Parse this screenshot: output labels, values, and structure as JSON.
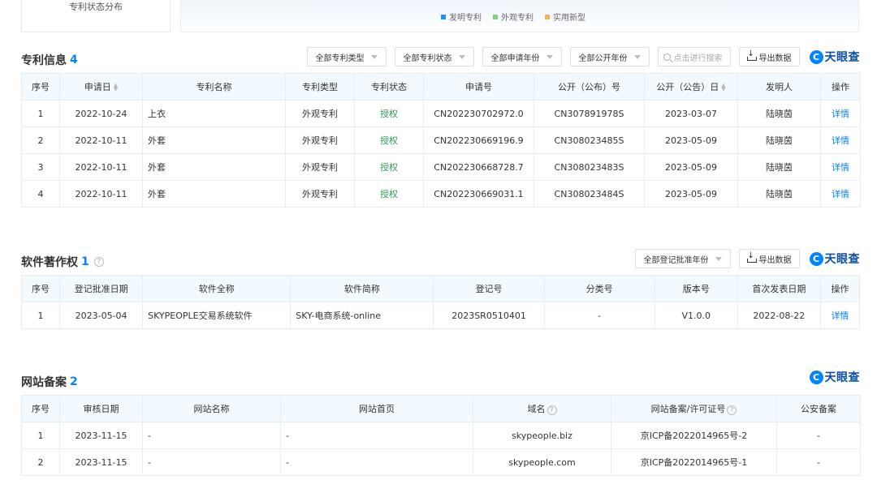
{
  "top": {
    "left_label": "专利状态分布",
    "legend": [
      {
        "label": "发明专利",
        "color": "#1890ff"
      },
      {
        "label": "外观专利",
        "color": "#7ed37f"
      },
      {
        "label": "实用新型",
        "color": "#f5b45a"
      }
    ]
  },
  "brand": {
    "logo_char": "C",
    "name": "天眼查"
  },
  "patents": {
    "title": "专利信息",
    "count": "4",
    "filters": [
      "全部专利类型",
      "全部专利状态",
      "全部申请年份",
      "全部公开年份"
    ],
    "search_placeholder": "点击进行搜索",
    "export_label": "导出数据",
    "columns": [
      "序号",
      "申请日",
      "专利名称",
      "专利类型",
      "专利状态",
      "申请号",
      "公开（公布）号",
      "公开（公告）日",
      "发明人",
      "操作"
    ],
    "rows": [
      {
        "no": "1",
        "apply_date": "2022-10-24",
        "name": "上衣",
        "type": "外观专利",
        "status": "授权",
        "apply_no": "CN202230702972.0",
        "pub_no": "CN307891978S",
        "pub_date": "2023-03-07",
        "inventor": "陆晓茵",
        "action": "详情"
      },
      {
        "no": "2",
        "apply_date": "2022-10-11",
        "name": "外套",
        "type": "外观专利",
        "status": "授权",
        "apply_no": "CN202230669196.9",
        "pub_no": "CN308023485S",
        "pub_date": "2023-05-09",
        "inventor": "陆晓茵",
        "action": "详情"
      },
      {
        "no": "3",
        "apply_date": "2022-10-11",
        "name": "外套",
        "type": "外观专利",
        "status": "授权",
        "apply_no": "CN202230668728.7",
        "pub_no": "CN308023483S",
        "pub_date": "2023-05-09",
        "inventor": "陆晓茵",
        "action": "详情"
      },
      {
        "no": "4",
        "apply_date": "2022-10-11",
        "name": "外套",
        "type": "外观专利",
        "status": "授权",
        "apply_no": "CN202230669031.1",
        "pub_no": "CN308023484S",
        "pub_date": "2023-05-09",
        "inventor": "陆晓茵",
        "action": "详情"
      }
    ]
  },
  "software": {
    "title": "软件著作权",
    "count": "1",
    "filter": "全部登记批准年份",
    "export_label": "导出数据",
    "columns": [
      "序号",
      "登记批准日期",
      "软件全称",
      "软件简称",
      "登记号",
      "分类号",
      "版本号",
      "首次发表日期",
      "操作"
    ],
    "rows": [
      {
        "no": "1",
        "approve_date": "2023-05-04",
        "full_name": "SKYPEOPLE交易系统软件",
        "short_name": "SKY-电商系统-online",
        "reg_no": "2023SR0510401",
        "class_no": "-",
        "version": "V1.0.0",
        "first_pub": "2022-08-22",
        "action": "详情"
      }
    ]
  },
  "websites": {
    "title": "网站备案",
    "count": "2",
    "columns": [
      "序号",
      "审核日期",
      "网站名称",
      "网站首页",
      "域名",
      "网站备案/许可证号",
      "公安备案"
    ],
    "rows": [
      {
        "no": "1",
        "date": "2023-11-15",
        "site_name": "-",
        "home": "-",
        "domain": "skypeople.biz",
        "icp": "京ICP备2022014965号-2",
        "police": "-"
      },
      {
        "no": "2",
        "date": "2023-11-15",
        "site_name": "-",
        "home": "-",
        "domain": "skypeople.com",
        "icp": "京ICP备2022014965号-1",
        "police": "-"
      }
    ]
  }
}
